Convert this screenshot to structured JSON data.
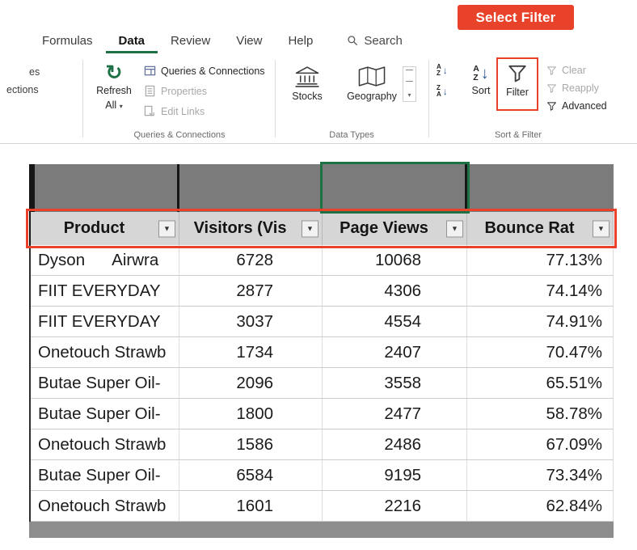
{
  "colors": {
    "accent": "#E8432A",
    "excel_green": "#1E7145"
  },
  "icons": {
    "dropdown": "▼",
    "dropdown_small": "▾",
    "refresh": "↻",
    "sort_arrow_down": "↓",
    "sort_az": [
      "A",
      "Z"
    ],
    "sort_za": [
      "Z",
      "A"
    ]
  },
  "callout": {
    "label": "Select Filter"
  },
  "ribbon": {
    "tabs": [
      {
        "label": "Formulas",
        "active": false
      },
      {
        "label": "Data",
        "active": true
      },
      {
        "label": "Review",
        "active": false
      },
      {
        "label": "View",
        "active": false
      },
      {
        "label": "Help",
        "active": false
      }
    ],
    "search_label": "Search",
    "clipped_left": [
      "es",
      "ections"
    ],
    "refresh": {
      "line1": "Refresh",
      "line2": "All"
    },
    "queries_group": {
      "label": "Queries & Connections",
      "items": [
        {
          "label": "Queries & Connections",
          "disabled": false
        },
        {
          "label": "Properties",
          "disabled": true
        },
        {
          "label": "Edit Links",
          "disabled": true
        }
      ]
    },
    "data_types_group": {
      "label": "Data Types",
      "items": [
        "Stocks",
        "Geography"
      ]
    },
    "sort_filter_group": {
      "label": "Sort & Filter",
      "sort_label": "Sort",
      "filter_label": "Filter",
      "items": [
        {
          "label": "Clear",
          "disabled": true
        },
        {
          "label": "Reapply",
          "disabled": true
        },
        {
          "label": "Advanced",
          "disabled": false
        }
      ]
    }
  },
  "table": {
    "columns": [
      {
        "header": "Product"
      },
      {
        "header": "Visitors (Vis"
      },
      {
        "header": "Page Views"
      },
      {
        "header": "Bounce Rat"
      }
    ],
    "rows": [
      [
        "Dyson      Airwra",
        "6728",
        "10068",
        "77.13%"
      ],
      [
        "FIIT EVERYDAY",
        "2877",
        "4306",
        "74.14%"
      ],
      [
        "FIIT EVERYDAY",
        "3037",
        "4554",
        "74.91%"
      ],
      [
        "Onetouch Strawb",
        "1734",
        "2407",
        "70.47%"
      ],
      [
        "Butae Super Oil-",
        "2096",
        "3558",
        "65.51%"
      ],
      [
        "Butae Super Oil-",
        "1800",
        "2477",
        "58.78%"
      ],
      [
        "Onetouch Strawb",
        "1586",
        "2486",
        "67.09%"
      ],
      [
        "Butae Super Oil-",
        "6584",
        "9195",
        "73.34%"
      ],
      [
        "Onetouch Strawb",
        "1601",
        "2216",
        "62.84%"
      ]
    ]
  }
}
